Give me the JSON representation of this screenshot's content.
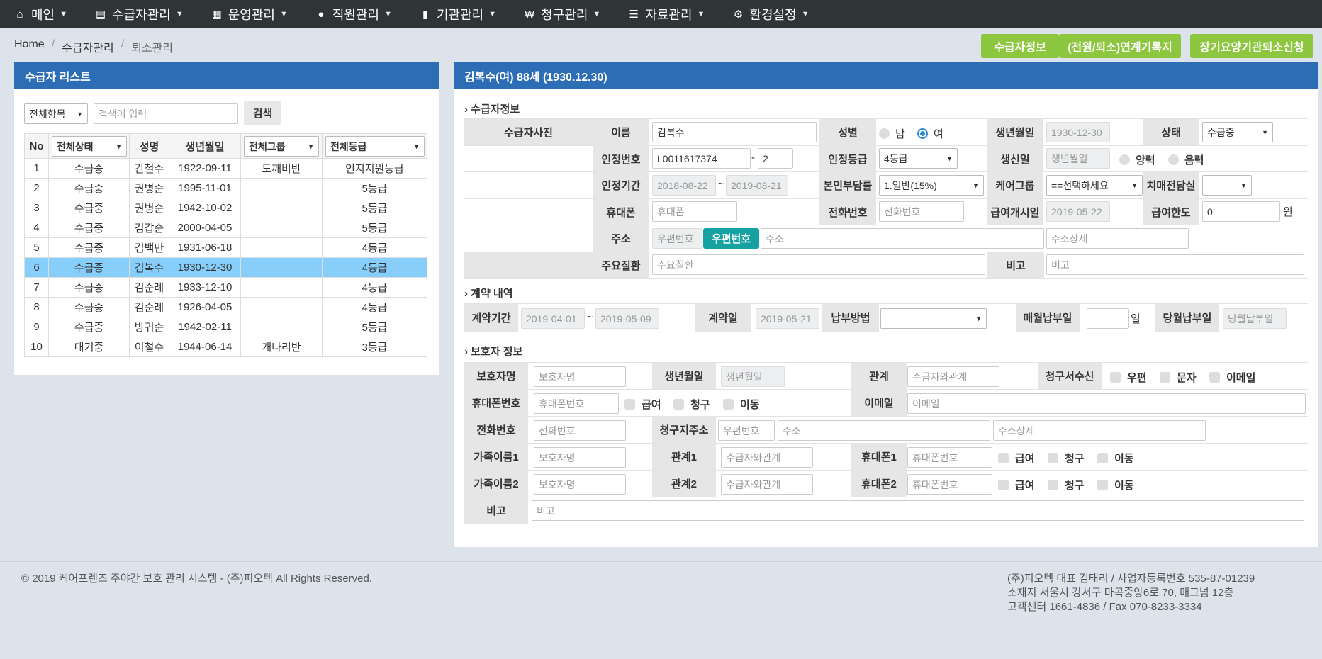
{
  "nav": [
    {
      "label": "메인",
      "icon": "home-icon",
      "glyph": "⌂"
    },
    {
      "label": "수급자관리",
      "icon": "id-card-icon",
      "glyph": "▤"
    },
    {
      "label": "운영관리",
      "icon": "calendar-icon",
      "glyph": "▦"
    },
    {
      "label": "직원관리",
      "icon": "users-icon",
      "glyph": "●"
    },
    {
      "label": "기관관리",
      "icon": "building-icon",
      "glyph": "▮"
    },
    {
      "label": "청구관리",
      "icon": "won-icon",
      "glyph": "₩"
    },
    {
      "label": "자료관리",
      "icon": "list-icon",
      "glyph": "☰"
    },
    {
      "label": "환경설정",
      "icon": "gear-icon",
      "glyph": "⚙"
    }
  ],
  "breadcrumb": {
    "home": "Home",
    "section": "수급자관리",
    "current": "퇴소관리",
    "sep": "/"
  },
  "top_buttons": {
    "info": "수급자정보",
    "transfer": "(전원/퇴소)연계기록지",
    "ltc": "장기요양기관퇴소신청"
  },
  "list_panel": {
    "title": "수급자 리스트",
    "filter": "전체항목",
    "search_placeholder": "검색어 입력",
    "search_button": "검색",
    "headers": {
      "no": "No",
      "status": "전체상태",
      "name": "성명",
      "birth": "생년월일",
      "group": "전체그룹",
      "grade": "전체등급"
    },
    "rows": [
      {
        "no": "1",
        "status": "수급중",
        "name": "간철수",
        "birth": "1922-09-11",
        "group": "도깨비반",
        "grade": "인지지원등급"
      },
      {
        "no": "2",
        "status": "수급중",
        "name": "권병순",
        "birth": "1995-11-01",
        "group": "",
        "grade": "5등급"
      },
      {
        "no": "3",
        "status": "수급중",
        "name": "권병순",
        "birth": "1942-10-02",
        "group": "",
        "grade": "5등급"
      },
      {
        "no": "4",
        "status": "수급중",
        "name": "김갑순",
        "birth": "2000-04-05",
        "group": "",
        "grade": "5등급"
      },
      {
        "no": "5",
        "status": "수급중",
        "name": "김백만",
        "birth": "1931-06-18",
        "group": "",
        "grade": "4등급"
      },
      {
        "no": "6",
        "status": "수급중",
        "name": "김복수",
        "birth": "1930-12-30",
        "group": "",
        "grade": "4등급"
      },
      {
        "no": "7",
        "status": "수급중",
        "name": "김순례",
        "birth": "1933-12-10",
        "group": "",
        "grade": "4등급"
      },
      {
        "no": "8",
        "status": "수급중",
        "name": "김순례",
        "birth": "1926-04-05",
        "group": "",
        "grade": "4등급"
      },
      {
        "no": "9",
        "status": "수급중",
        "name": "방귀순",
        "birth": "1942-02-11",
        "group": "",
        "grade": "5등급"
      },
      {
        "no": "10",
        "status": "대기중",
        "name": "이철수",
        "birth": "1944-06-14",
        "group": "개나리반",
        "grade": "3등급"
      }
    ],
    "selected_index": 5,
    "highlight_color": "#87cefa"
  },
  "detail": {
    "title": "김복수(여) 88세 (1930.12.30)",
    "sec1": "수급자정보",
    "photo_label": "수급자사진",
    "labels": {
      "name": "이름",
      "gender": "성별",
      "birth": "생년월일",
      "state": "상태",
      "cert_no": "인정번호",
      "cert_grade": "인정등급",
      "birthday": "생신일",
      "cert_period": "인정기간",
      "copay": "본인부담률",
      "care_group": "케어그룹",
      "dementia": "치매전담실",
      "mobile": "휴대폰",
      "phone": "전화번호",
      "start_date": "급여개시일",
      "limit": "급여한도",
      "address": "주소",
      "disease": "주요질환",
      "note": "비고"
    },
    "values": {
      "name": "김복수",
      "male": "남",
      "female": "여",
      "birth": "1930-12-30",
      "state": "수급중",
      "cert_no": "L0011617374",
      "cert_dash": "-",
      "cert_no2": "2",
      "cert_grade": "4등급",
      "birthday_ph": "생년월일",
      "solar": "양력",
      "lunar": "음력",
      "period_from": "2018-08-22",
      "tilde": "~",
      "period_to": "2019-08-21",
      "copay": "1.일반(15%)",
      "care_group": "==선택하세요",
      "dementia": "",
      "mobile_ph": "휴대폰",
      "phone_ph": "전화번호",
      "start_date": "2019-05-22",
      "limit": "0",
      "won": "원",
      "zip_ph": "우편번호",
      "zip_btn": "우편번호",
      "addr_ph": "주소",
      "addr_detail_ph": "주소상세",
      "disease_ph": "주요질환",
      "note_ph": "비고"
    },
    "sec2": "계약 내역",
    "contract": {
      "period_label": "계약기간",
      "from": "2019-04-01",
      "tilde": "~",
      "to": "2019-05-09",
      "date_label": "계약일",
      "date": "2019-05-21",
      "pay_label": "납부방법",
      "pay": "",
      "monthly_label": "매월납부일",
      "monthly": "",
      "day": "일",
      "curr_label": "당월납부일",
      "curr_ph": "당월납부일"
    },
    "sec3": "보호자 정보",
    "guardian": {
      "labels": {
        "name": "보호자명",
        "birth": "생년월일",
        "relation": "관계",
        "bill": "청구서수신",
        "mobile": "휴대폰번호",
        "email": "이메일",
        "phone": "전화번호",
        "bill_addr": "청구지주소",
        "fam1": "가족이름1",
        "rel1": "관계1",
        "mob1": "휴대폰1",
        "fam2": "가족이름2",
        "rel2": "관계2",
        "mob2": "휴대폰2",
        "note": "비고"
      },
      "ph": {
        "name": "보호자명",
        "birth": "생년월일",
        "relation": "수급자와관계",
        "mobile": "휴대폰번호",
        "email": "이메일",
        "phone": "전화번호",
        "zip": "우편번호",
        "addr": "주소",
        "addr_detail": "주소상세",
        "fam": "보호자명",
        "rel": "수급자와관계",
        "mob": "휴대폰번호",
        "note": "비고"
      },
      "chk": {
        "post": "우편",
        "sms": "문자",
        "mail": "이메일",
        "pay": "급여",
        "claim": "청구",
        "move": "이동"
      }
    }
  },
  "footer": {
    "copyright": "© 2019 케어프렌즈 주야간 보호 관리 시스템 - (주)피오텍 All Rights Reserved.",
    "line1": "(주)피오텍   대표  김태리   /   사업자등록번호   535-87-01239",
    "line2": "소재지   서울시 강서구 마곡중앙6로 70, 매그넘 12층",
    "line3": "고객센터   1661-4836   /   Fax   070-8233-3334"
  },
  "colors": {
    "nav_bg": "#2f3437",
    "panel_header": "#2d6db5",
    "green_button": "#8dc63f",
    "teal_button": "#17a2a2"
  }
}
